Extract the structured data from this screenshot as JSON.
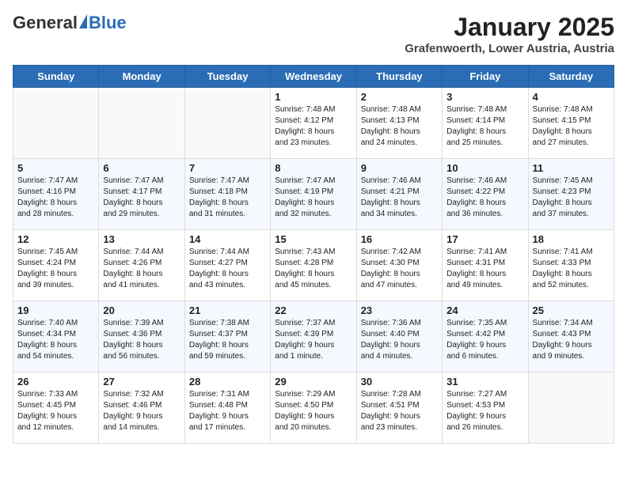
{
  "header": {
    "logo_general": "General",
    "logo_blue": "Blue",
    "month_title": "January 2025",
    "subtitle": "Grafenwoerth, Lower Austria, Austria"
  },
  "weekdays": [
    "Sunday",
    "Monday",
    "Tuesday",
    "Wednesday",
    "Thursday",
    "Friday",
    "Saturday"
  ],
  "weeks": [
    [
      {
        "day": "",
        "info": ""
      },
      {
        "day": "",
        "info": ""
      },
      {
        "day": "",
        "info": ""
      },
      {
        "day": "1",
        "info": "Sunrise: 7:48 AM\nSunset: 4:12 PM\nDaylight: 8 hours\nand 23 minutes."
      },
      {
        "day": "2",
        "info": "Sunrise: 7:48 AM\nSunset: 4:13 PM\nDaylight: 8 hours\nand 24 minutes."
      },
      {
        "day": "3",
        "info": "Sunrise: 7:48 AM\nSunset: 4:14 PM\nDaylight: 8 hours\nand 25 minutes."
      },
      {
        "day": "4",
        "info": "Sunrise: 7:48 AM\nSunset: 4:15 PM\nDaylight: 8 hours\nand 27 minutes."
      }
    ],
    [
      {
        "day": "5",
        "info": "Sunrise: 7:47 AM\nSunset: 4:16 PM\nDaylight: 8 hours\nand 28 minutes."
      },
      {
        "day": "6",
        "info": "Sunrise: 7:47 AM\nSunset: 4:17 PM\nDaylight: 8 hours\nand 29 minutes."
      },
      {
        "day": "7",
        "info": "Sunrise: 7:47 AM\nSunset: 4:18 PM\nDaylight: 8 hours\nand 31 minutes."
      },
      {
        "day": "8",
        "info": "Sunrise: 7:47 AM\nSunset: 4:19 PM\nDaylight: 8 hours\nand 32 minutes."
      },
      {
        "day": "9",
        "info": "Sunrise: 7:46 AM\nSunset: 4:21 PM\nDaylight: 8 hours\nand 34 minutes."
      },
      {
        "day": "10",
        "info": "Sunrise: 7:46 AM\nSunset: 4:22 PM\nDaylight: 8 hours\nand 36 minutes."
      },
      {
        "day": "11",
        "info": "Sunrise: 7:45 AM\nSunset: 4:23 PM\nDaylight: 8 hours\nand 37 minutes."
      }
    ],
    [
      {
        "day": "12",
        "info": "Sunrise: 7:45 AM\nSunset: 4:24 PM\nDaylight: 8 hours\nand 39 minutes."
      },
      {
        "day": "13",
        "info": "Sunrise: 7:44 AM\nSunset: 4:26 PM\nDaylight: 8 hours\nand 41 minutes."
      },
      {
        "day": "14",
        "info": "Sunrise: 7:44 AM\nSunset: 4:27 PM\nDaylight: 8 hours\nand 43 minutes."
      },
      {
        "day": "15",
        "info": "Sunrise: 7:43 AM\nSunset: 4:28 PM\nDaylight: 8 hours\nand 45 minutes."
      },
      {
        "day": "16",
        "info": "Sunrise: 7:42 AM\nSunset: 4:30 PM\nDaylight: 8 hours\nand 47 minutes."
      },
      {
        "day": "17",
        "info": "Sunrise: 7:41 AM\nSunset: 4:31 PM\nDaylight: 8 hours\nand 49 minutes."
      },
      {
        "day": "18",
        "info": "Sunrise: 7:41 AM\nSunset: 4:33 PM\nDaylight: 8 hours\nand 52 minutes."
      }
    ],
    [
      {
        "day": "19",
        "info": "Sunrise: 7:40 AM\nSunset: 4:34 PM\nDaylight: 8 hours\nand 54 minutes."
      },
      {
        "day": "20",
        "info": "Sunrise: 7:39 AM\nSunset: 4:36 PM\nDaylight: 8 hours\nand 56 minutes."
      },
      {
        "day": "21",
        "info": "Sunrise: 7:38 AM\nSunset: 4:37 PM\nDaylight: 8 hours\nand 59 minutes."
      },
      {
        "day": "22",
        "info": "Sunrise: 7:37 AM\nSunset: 4:39 PM\nDaylight: 9 hours\nand 1 minute."
      },
      {
        "day": "23",
        "info": "Sunrise: 7:36 AM\nSunset: 4:40 PM\nDaylight: 9 hours\nand 4 minutes."
      },
      {
        "day": "24",
        "info": "Sunrise: 7:35 AM\nSunset: 4:42 PM\nDaylight: 9 hours\nand 6 minutes."
      },
      {
        "day": "25",
        "info": "Sunrise: 7:34 AM\nSunset: 4:43 PM\nDaylight: 9 hours\nand 9 minutes."
      }
    ],
    [
      {
        "day": "26",
        "info": "Sunrise: 7:33 AM\nSunset: 4:45 PM\nDaylight: 9 hours\nand 12 minutes."
      },
      {
        "day": "27",
        "info": "Sunrise: 7:32 AM\nSunset: 4:46 PM\nDaylight: 9 hours\nand 14 minutes."
      },
      {
        "day": "28",
        "info": "Sunrise: 7:31 AM\nSunset: 4:48 PM\nDaylight: 9 hours\nand 17 minutes."
      },
      {
        "day": "29",
        "info": "Sunrise: 7:29 AM\nSunset: 4:50 PM\nDaylight: 9 hours\nand 20 minutes."
      },
      {
        "day": "30",
        "info": "Sunrise: 7:28 AM\nSunset: 4:51 PM\nDaylight: 9 hours\nand 23 minutes."
      },
      {
        "day": "31",
        "info": "Sunrise: 7:27 AM\nSunset: 4:53 PM\nDaylight: 9 hours\nand 26 minutes."
      },
      {
        "day": "",
        "info": ""
      }
    ]
  ]
}
